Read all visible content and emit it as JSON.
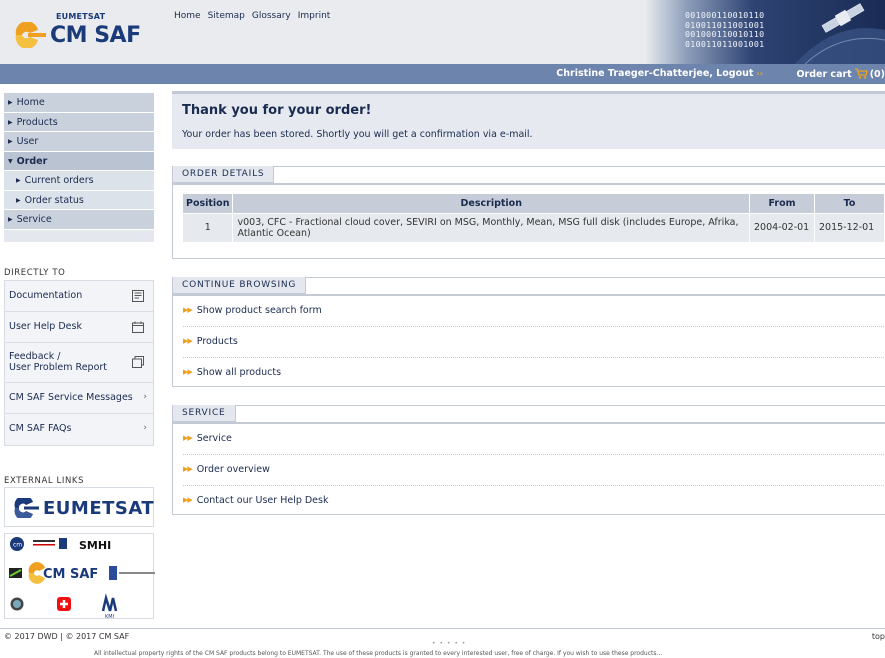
{
  "header": {
    "logo_top": "EUMETSAT",
    "logo_main": "CM SAF",
    "nav": [
      "Home",
      "Sitemap",
      "Glossary",
      "Imprint"
    ],
    "binary_lines": [
      "001000110010110",
      "010011011001001",
      "001000110010110",
      "010011011001001"
    ]
  },
  "userbar": {
    "user": "Christine Traeger-Chatterjee, Logout",
    "cart_label": "Order cart",
    "cart_count": "(0)"
  },
  "sidebar": {
    "menu": [
      {
        "label": "Home"
      },
      {
        "label": "Products"
      },
      {
        "label": "User"
      },
      {
        "label": "Order"
      },
      {
        "label": "Current orders"
      },
      {
        "label": "Order status"
      },
      {
        "label": "Service"
      }
    ],
    "directly_to_heading": "DIRECTLY TO",
    "directly_to": [
      {
        "label": "Documentation",
        "icon": "document-icon"
      },
      {
        "label": "User Help Desk",
        "icon": "helpdesk-icon"
      },
      {
        "label_line1": "Feedback /",
        "label_line2": "User Problem Report",
        "icon": "feedback-icon"
      },
      {
        "label": "CM SAF Service Messages",
        "icon": "chevron-right-icon"
      },
      {
        "label": "CM SAF FAQs",
        "icon": "chevron-right-icon"
      }
    ],
    "external_heading": "EXTERNAL LINKS",
    "eumetsat_logo": "EUMETSAT",
    "partners": {
      "smhi": "SMHI",
      "cmsaf": "CM SAF",
      "kmi": "KMI"
    }
  },
  "main": {
    "thanks_title": "Thank you for your order!",
    "thanks_text": "Your order has been stored. Shortly you will get a confirmation via e-mail.",
    "order_details": {
      "tab": "ORDER DETAILS",
      "columns": [
        "Position",
        "Description",
        "From",
        "To"
      ],
      "rows": [
        {
          "position": "1",
          "description": "v003, CFC - Fractional cloud cover, SEVIRI on MSG, Monthly, Mean, MSG full disk (includes Europe, Afrika, Atlantic Ocean)",
          "from": "2004-02-01",
          "to": "2015-12-01"
        }
      ]
    },
    "continue_browsing": {
      "tab": "CONTINUE BROWSING",
      "links": [
        "Show product search form",
        "Products",
        "Show all products"
      ]
    },
    "service": {
      "tab": "SERVICE",
      "links": [
        "Service",
        "Order overview",
        "Contact our User Help Desk"
      ]
    }
  },
  "footer": {
    "copyright": "© 2017 DWD | © 2017 CM SAF",
    "top": "top",
    "dots": "• • • • •",
    "legal": "All intellectual property rights of the CM SAF products belong to EUMETSAT. The use of these products is granted to every interested user, free of charge. If you wish to use these products..."
  },
  "colors": {
    "navy": "#1a2b50",
    "blue_bar": "#6d84ad",
    "accent_orange": "#f0a020",
    "panel_border": "#c3cad6"
  }
}
